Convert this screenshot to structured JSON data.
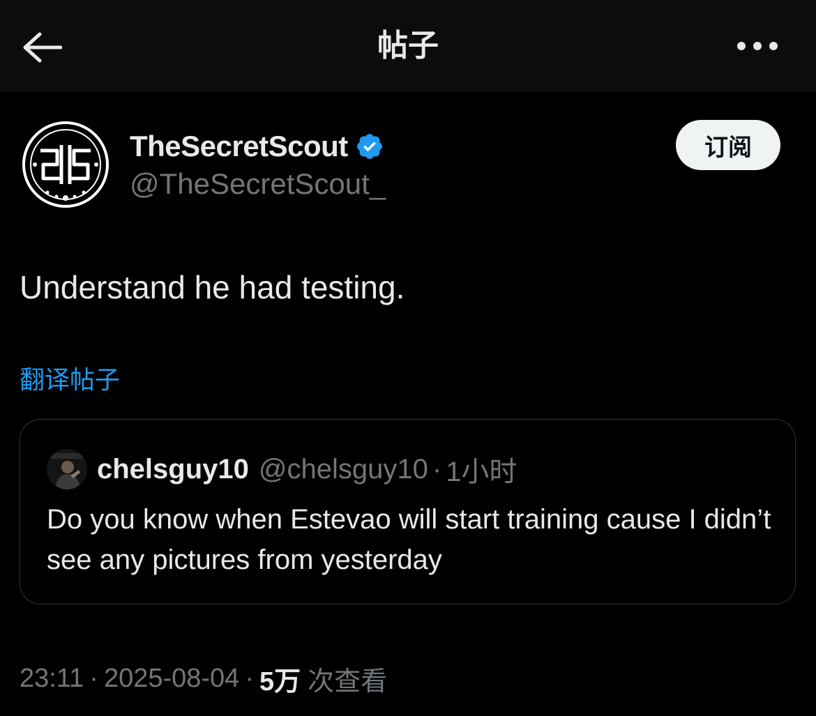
{
  "header": {
    "title": "帖子",
    "back_icon": "arrow-left-icon",
    "more_icon": "more-horizontal-icon"
  },
  "author": {
    "display_name": "TheSecretScout",
    "handle": "@TheSecretScout_",
    "avatar_icon": "tss-logo-avatar",
    "verified_icon": "verified-badge-icon",
    "verified_color": "#1d9bf0",
    "subscribe_label": "订阅"
  },
  "post": {
    "text": "Understand he had testing.",
    "translate_label": "翻译帖子"
  },
  "quote": {
    "display_name": "chelsguy10",
    "handle": "@chelsguy10",
    "separator": "·",
    "time": "1小时",
    "text": "Do you know when Estevao will start training cause I didn’t see any pictures from yesterday"
  },
  "meta": {
    "time": "23:11",
    "separator": "·",
    "date": "2025-08-04",
    "views_count": "5万",
    "views_label": "次查看"
  },
  "colors": {
    "background": "#000000",
    "topbar": "#0c0c0c",
    "text_primary": "#e7e9ea",
    "text_secondary": "#71767b",
    "accent": "#1d9bf0",
    "border": "#2f3336"
  }
}
